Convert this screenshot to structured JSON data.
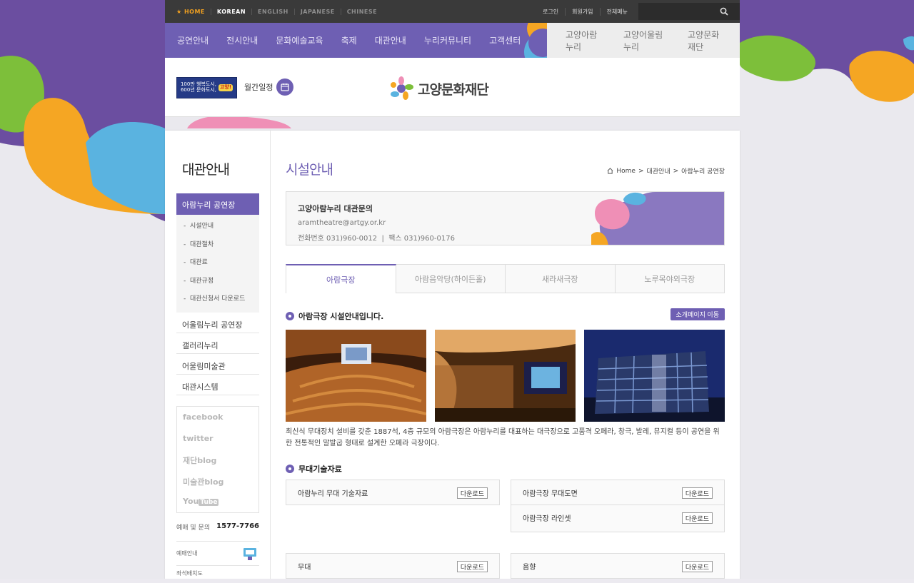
{
  "topbar": {
    "languages": [
      "HOME",
      "KOREAN",
      "ENGLISH",
      "JAPANESE",
      "CHINESE"
    ],
    "util": [
      "로그인",
      "회원가입",
      "전체메뉴"
    ],
    "search_placeholder": ""
  },
  "gnb": {
    "menu": [
      "공연안내",
      "전시안내",
      "문화예술교육",
      "축제",
      "대관안내",
      "누리커뮤니티",
      "고객센터"
    ],
    "sites": [
      "고양아람누리",
      "고양어울림누리",
      "고양문화재단"
    ]
  },
  "header": {
    "banner_line1": "100만 행복도시,",
    "banner_line2": "600년 문화도시,",
    "banner_highlight": "고양!",
    "monthly": "월간일정",
    "logo": "고양문화재단"
  },
  "lnb": {
    "title": "대관안내",
    "active": "아람누리 공연장",
    "sub": [
      "시설안내",
      "대관절차",
      "대관료",
      "대관규정",
      "대관신청서 다운로드"
    ],
    "others": [
      "어울림누리 공연장",
      "갤러리누리",
      "어울림미술관",
      "대관시스템"
    ],
    "sns": [
      "facebook",
      "twitter",
      "재단blog",
      "미술관blog",
      "You"
    ],
    "sns_yt": "Tube",
    "phone_label": "예매 및 문의",
    "phone_number": "1577-7766",
    "booking": "예매안내",
    "seat": "좌석배치도"
  },
  "main": {
    "title": "시설안내",
    "breadcrumb": [
      "Home",
      "대관안내",
      "아람누리 공연장"
    ],
    "contact": {
      "title": "고양아람누리 대관문의",
      "email": "aramtheatre@artgy.or.kr",
      "phone": "전화번호 031)960-0012",
      "fax": "팩스 031)960-0176"
    },
    "tabs": [
      "아람극장",
      "아람음악당(하이든홀)",
      "새라새극장",
      "노루목야외극장"
    ],
    "section1": "아람극장 시설안내입니다.",
    "intro_button": "소개페이지 이동",
    "description": "최신식 무대장치 설비를 갖춘 1887석, 4층 규모의 아람극장은 아람누리를 대표하는 대극장으로 고품격 오페라, 창극, 발레, 뮤지컬 등이 공연을 위한 전통적인 말발굽 형태로 설계한 오페라 극장이다.",
    "section2": "무대기술자료",
    "download_label": "다운로드",
    "downloads_left": [
      "아람누리 무대 기술자료"
    ],
    "downloads_right": [
      "아람극장 무대도면",
      "아람극장 라인셋"
    ],
    "downloads_bottom_left": [
      "무대"
    ],
    "downloads_bottom_right": [
      "음향"
    ]
  },
  "colors": {
    "primary": "#6e5fb3",
    "topbar": "#3a3a3a",
    "orange": "#f5a623",
    "blue": "#5ab3e0",
    "green": "#7dbf3a"
  }
}
